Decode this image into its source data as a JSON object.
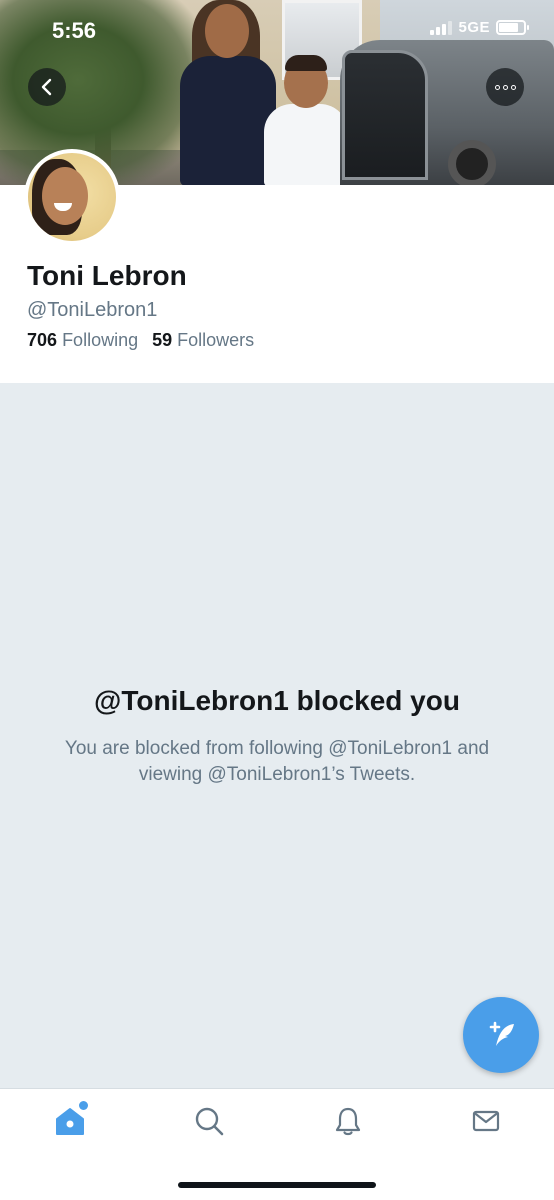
{
  "status_bar": {
    "time": "5:56",
    "network": "5GE"
  },
  "profile": {
    "name": "Toni Lebron",
    "handle": "@ToniLebron1",
    "following_count": "706",
    "following_label": "Following",
    "followers_count": "59",
    "followers_label": "Followers"
  },
  "blocked": {
    "title": "@ToniLebron1 blocked you",
    "description": "You are blocked from following @ToniLebron1 and viewing @ToniLebron1’s Tweets."
  },
  "tabs": [
    {
      "id": "home",
      "icon": "home-icon",
      "active": true
    },
    {
      "id": "search",
      "icon": "search-icon",
      "active": false
    },
    {
      "id": "notifications",
      "icon": "bell-icon",
      "active": false
    },
    {
      "id": "messages",
      "icon": "mail-icon",
      "active": false
    }
  ],
  "colors": {
    "accent": "#4a9ee9",
    "text_primary": "#14171a",
    "text_secondary": "#657786",
    "blocked_background": "#e6ecf0"
  }
}
